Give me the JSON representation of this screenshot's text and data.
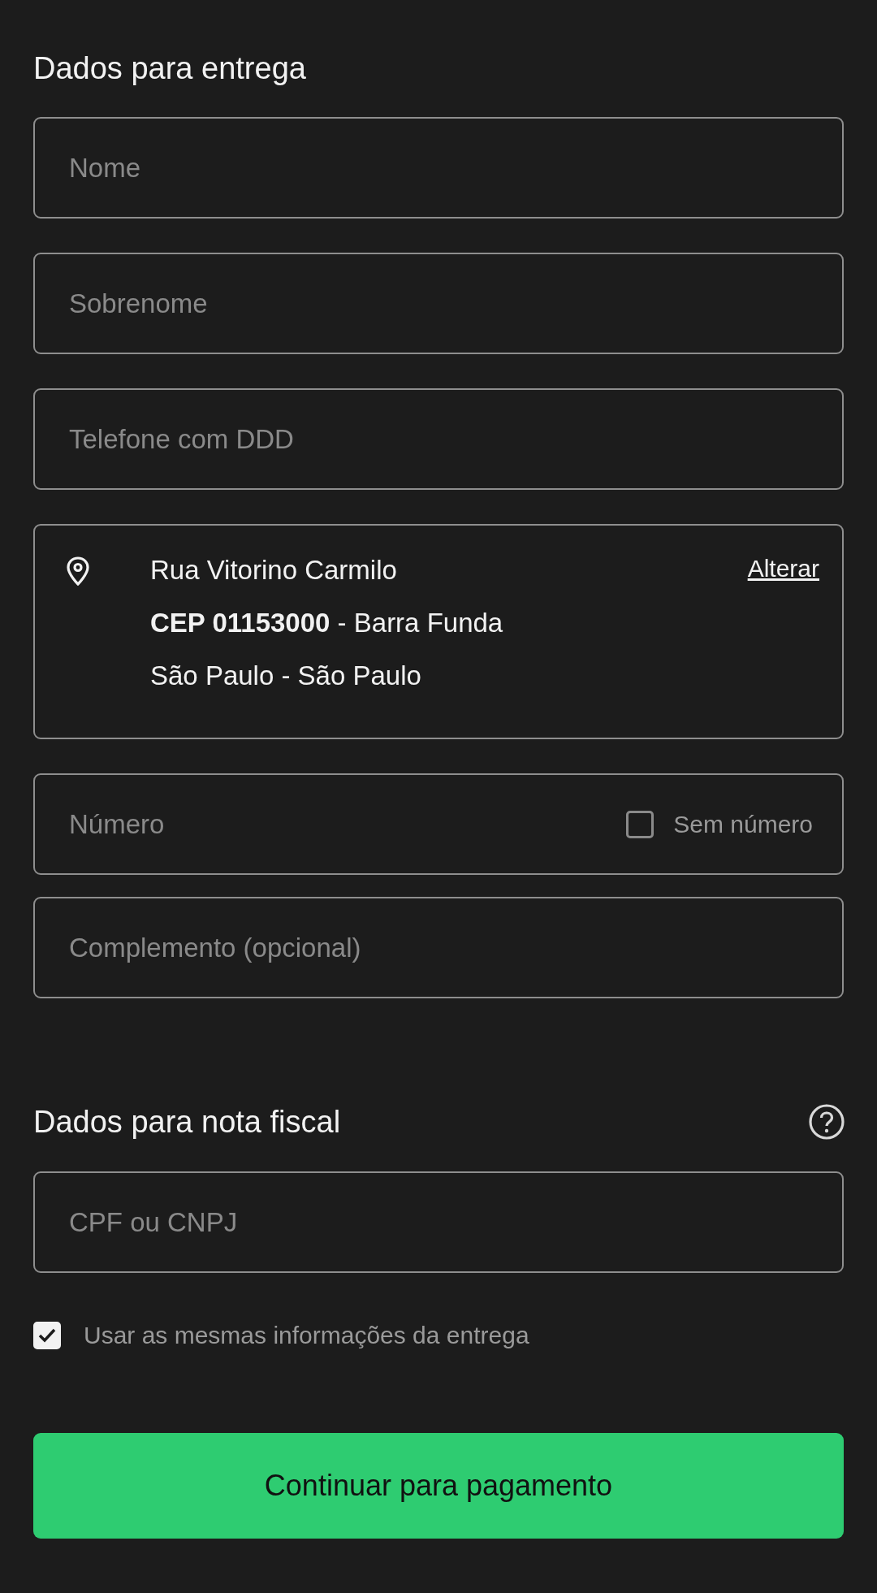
{
  "delivery": {
    "title": "Dados para entrega",
    "fields": [
      {
        "placeholder": "Nome"
      },
      {
        "placeholder": "Sobrenome"
      },
      {
        "placeholder": "Telefone com DDD"
      }
    ],
    "address": {
      "lines": [
        "Rua Vitorino Carmilo",
        "**CEP 01153000** - Barra Funda",
        "São Paulo - São Paulo"
      ],
      "change_link": "Alterar"
    },
    "number": {
      "placeholder": "Número",
      "no_number": {
        "label": "Sem número",
        "checked": false
      }
    },
    "complement": {
      "placeholder": "Complemento (opcional)"
    }
  },
  "invoice": {
    "title": "Dados para nota fiscal",
    "field": {
      "placeholder": "CPF ou CNPJ"
    },
    "same_info": {
      "label": "Usar as mesmas informações da entrega",
      "checked": true
    }
  },
  "submit": "Continuar para pagamento"
}
